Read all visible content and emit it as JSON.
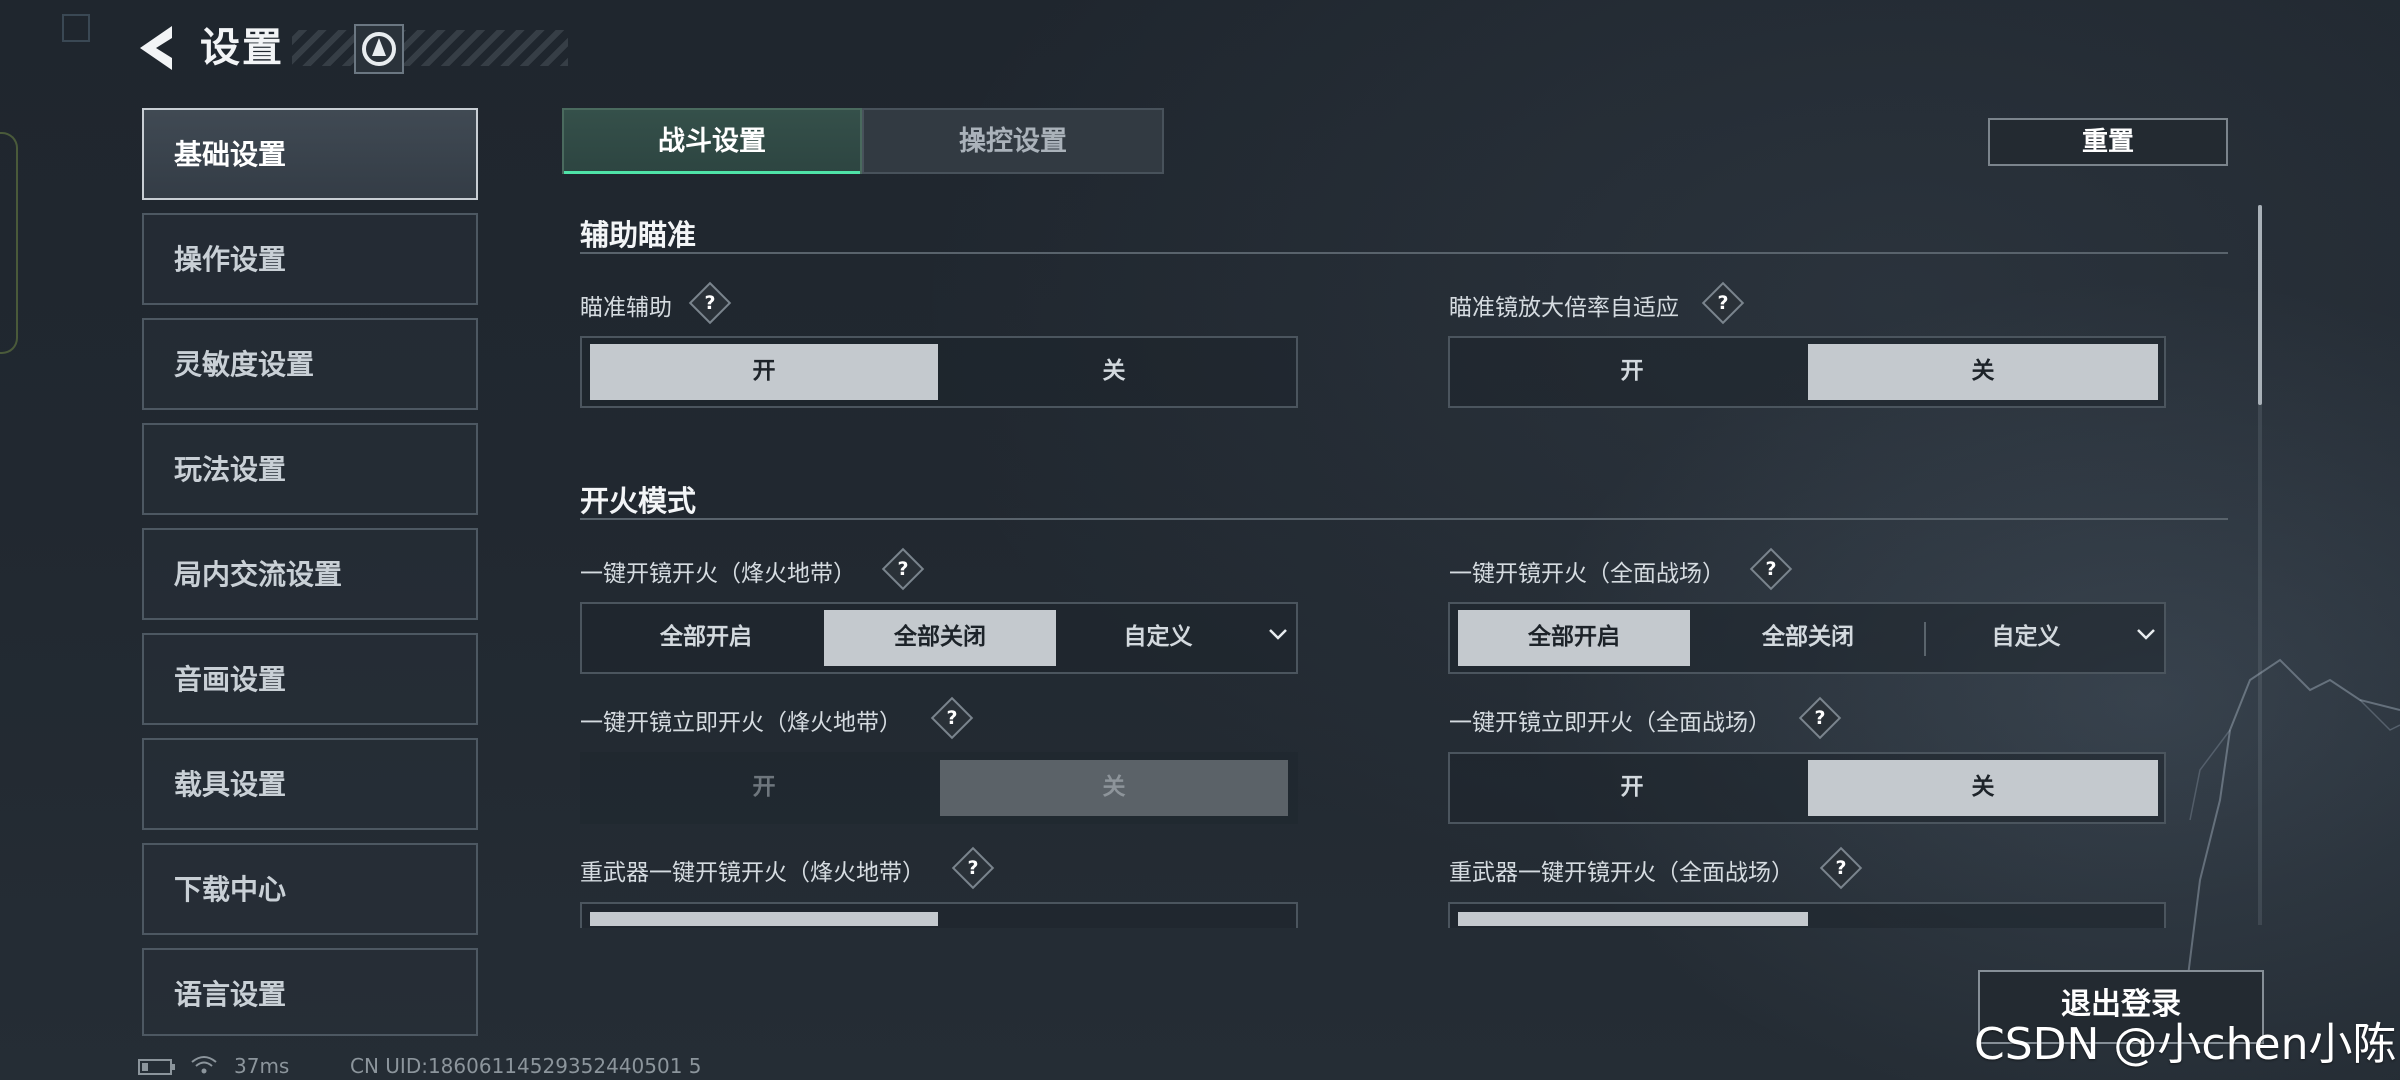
{
  "header": {
    "title": "设置"
  },
  "sidebar": {
    "items": [
      {
        "label": "基础设置"
      },
      {
        "label": "操作设置"
      },
      {
        "label": "灵敏度设置"
      },
      {
        "label": "玩法设置"
      },
      {
        "label": "局内交流设置"
      },
      {
        "label": "音画设置"
      },
      {
        "label": "载具设置"
      },
      {
        "label": "下载中心"
      },
      {
        "label": "语言设置"
      }
    ],
    "active_index": 0
  },
  "tabs": [
    {
      "label": "战斗设置"
    },
    {
      "label": "操控设置"
    }
  ],
  "reset_label": "重置",
  "sections": {
    "aim": {
      "title": "辅助瞄准",
      "aim_assist": {
        "label": "瞄准辅助",
        "on": "开",
        "off": "关",
        "selected": "开"
      },
      "scope_adapt": {
        "label": "瞄准镜放大倍率自适应",
        "on": "开",
        "off": "关",
        "selected": "关"
      }
    },
    "fire": {
      "title": "开火模式",
      "scope_fire_left": {
        "label": "一键开镜开火（烽火地带）",
        "options": [
          "全部开启",
          "全部关闭",
          "自定义"
        ],
        "selected": "全部关闭"
      },
      "scope_fire_right": {
        "label": "一键开镜开火（全面战场）",
        "options": [
          "全部开启",
          "全部关闭",
          "自定义"
        ],
        "selected": "全部开启"
      },
      "instant_fire_left": {
        "label": "一键开镜立即开火（烽火地带）",
        "on": "开",
        "off": "关",
        "selected": "关"
      },
      "instant_fire_right": {
        "label": "一键开镜立即开火（全面战场）",
        "on": "开",
        "off": "关",
        "selected": "关"
      },
      "heavy_left": {
        "label": "重武器一键开镜开火（烽火地带）"
      },
      "heavy_right": {
        "label": "重武器一键开镜开火（全面战场）"
      }
    }
  },
  "logout_label": "退出登录",
  "status": {
    "ping": "37ms",
    "uid": "CN UID:18606114529352440501 5"
  },
  "watermark": "CSDN @小chen小陈",
  "colors": {
    "accent": "#4fe3a8",
    "selected_bg": "#c4c9ce"
  },
  "icons": [
    "back-arrow-icon",
    "profile-badge-icon",
    "help-icon",
    "chevron-down-icon",
    "battery-icon",
    "wifi-icon"
  ]
}
